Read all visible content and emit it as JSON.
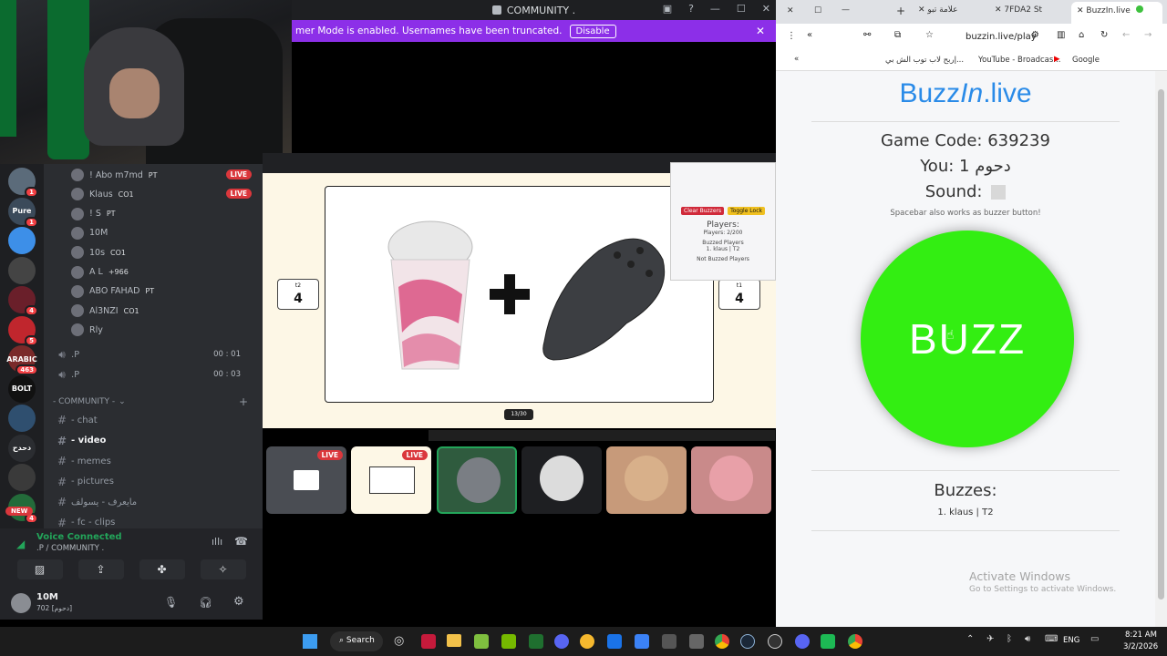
{
  "discord": {
    "window_title": "COMMUNITY .",
    "streamer_notice": "mer Mode is enabled. Usernames have been truncated.",
    "disable_label": "Disable",
    "voice_members": [
      {
        "name": "! Abo m7md",
        "badge": "PT",
        "live": true
      },
      {
        "name": "Klaus",
        "badge": "CO1",
        "live": true
      },
      {
        "name": "! S",
        "badge": "PT",
        "live": false
      },
      {
        "name": "10M",
        "badge": "",
        "live": false
      },
      {
        "name": "10s",
        "badge": "CO1",
        "live": false
      },
      {
        "name": "A L",
        "badge": "+966",
        "live": false
      },
      {
        "name": "ABO FAHAD",
        "badge": "PT",
        "live": false
      },
      {
        "name": "Al3NZI",
        "badge": "CO1",
        "live": false
      },
      {
        "name": "Rly",
        "badge": "",
        "live": false
      }
    ],
    "live_label": "LIVE",
    "voice_channels": [
      {
        "name": ".P",
        "time_a": "00",
        "time_b": "01"
      },
      {
        "name": ".P",
        "time_a": "00",
        "time_b": "03"
      }
    ],
    "category": "- COMMUNITY -",
    "text_channels": [
      {
        "name": "- chat",
        "active": false
      },
      {
        "name": "- video",
        "active": true
      },
      {
        "name": "- memes",
        "active": false
      },
      {
        "name": "- pictures",
        "active": false
      },
      {
        "name": "مايعرف - يسولف",
        "active": false
      },
      {
        "name": "- fc - clips",
        "active": false
      }
    ],
    "voice_status": "Voice Connected",
    "voice_location": ".P / COMMUNITY .",
    "user": {
      "name": "10M",
      "status": "702 [دحوم]"
    },
    "servers": [
      {
        "label": "",
        "color": "#5b6b7a",
        "badge": "1"
      },
      {
        "label": "Pure",
        "color": "#3b4a5a",
        "badge": "1"
      },
      {
        "label": "",
        "color": "#3d8fe8",
        "badge": ""
      },
      {
        "label": "",
        "color": "#444",
        "badge": ""
      },
      {
        "label": "",
        "color": "#6a1f2a",
        "badge": "4"
      },
      {
        "label": "",
        "color": "#c0262d",
        "badge": "5"
      },
      {
        "label": "ARABIC",
        "color": "#7a2a2a",
        "badge": "463"
      },
      {
        "label": "BOLT",
        "color": "#111",
        "badge": ""
      },
      {
        "label": "",
        "color": "#2f4f6f",
        "badge": ""
      },
      {
        "label": "دحدح",
        "color": "#2b2d31",
        "badge": ""
      },
      {
        "label": "",
        "color": "#3a3a3a",
        "badge": ""
      },
      {
        "label": "",
        "color": "#236b3a",
        "badge": "4"
      }
    ],
    "new_label": "NEW"
  },
  "screenshare": {
    "left_score": {
      "label": "t2",
      "value": "4"
    },
    "right_score": {
      "label": "t1",
      "value": "4"
    },
    "pager": "13/30",
    "overlay": {
      "clear_label": "Clear Buzzers",
      "lock_label": "Toggle Lock",
      "players_title": "Players:",
      "players_count": "Players: 2/200",
      "buzzed": "Buzzed Players",
      "buzzed_item": "1. klaus | T2",
      "not_buzzed": "Not Buzzed Players"
    }
  },
  "browser": {
    "tabs": [
      "علامة تبو",
      "7FDA2 St",
      "BuzzIn.live"
    ],
    "url": "buzzin.live/play",
    "bookmarks": [
      "إربح لاب توب الش بي...",
      "YouTube - Broadcas...",
      "Google"
    ]
  },
  "buzzin": {
    "logo_a": "Buzz",
    "logo_b": "In",
    "logo_c": ".live",
    "game_code": "Game Code: 639239",
    "you": "You: دحوم 1",
    "sound_label": "Sound:",
    "hint": "Spacebar also works as buzzer button!",
    "buzz_label": "BUZZ",
    "buzzes_title": "Buzzes:",
    "buzzes": [
      "1. klaus | T2"
    ],
    "activate_title": "Activate Windows",
    "activate_sub": "Go to Settings to activate Windows."
  },
  "taskbar": {
    "search_label": "Search",
    "lang": "ENG",
    "time": "8:21 AM",
    "date": "3/2/2026"
  },
  "colors": {
    "buzz_green": "#33ee12",
    "logo_blue": "#2a8be8",
    "discord_live": "#da373c",
    "notice_purple": "#8c2fe8"
  }
}
